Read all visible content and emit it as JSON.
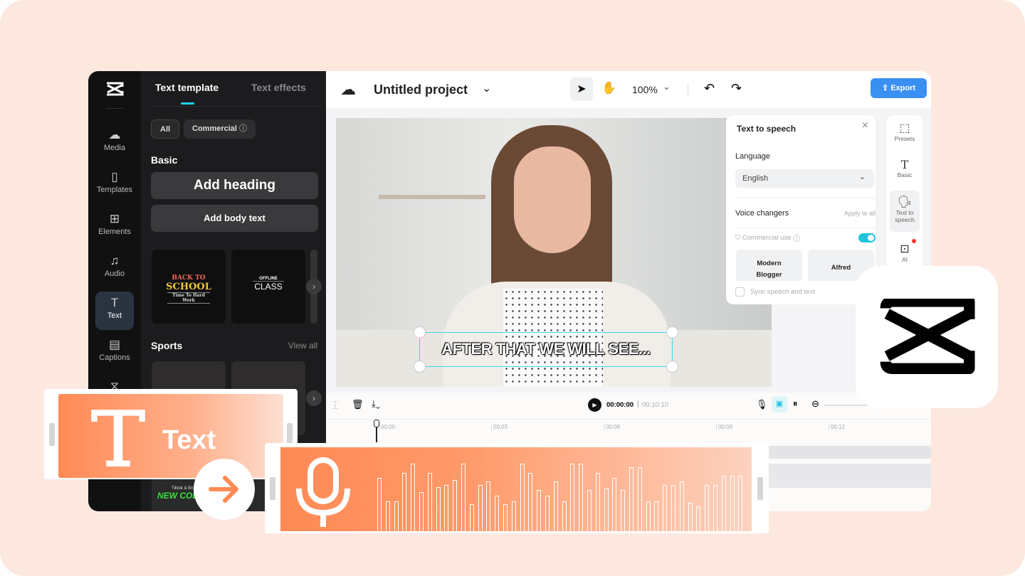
{
  "sidebar": {
    "items": [
      {
        "label": "Media",
        "icon": "cloud-upload-icon"
      },
      {
        "label": "Templates",
        "icon": "templates-icon"
      },
      {
        "label": "Elements",
        "icon": "elements-icon"
      },
      {
        "label": "Audio",
        "icon": "music-icon"
      },
      {
        "label": "Text",
        "icon": "text-icon",
        "active": true
      },
      {
        "label": "Captions",
        "icon": "captions-icon"
      },
      {
        "label": "Transitions",
        "icon": "transitions-icon"
      }
    ]
  },
  "panel": {
    "tabs": [
      {
        "label": "Text template",
        "active": true
      },
      {
        "label": "Text effects"
      }
    ],
    "filters": [
      "All",
      "Commercial"
    ],
    "basic_title": "Basic",
    "add_heading": "Add heading",
    "add_body": "Add body text",
    "cards": [
      {
        "line1": "BACK TO",
        "line2": "SCHOOL",
        "line3": "Time To Hard Work"
      },
      {
        "line1": "OFFLINE",
        "line2": "CLASS"
      }
    ],
    "sports_title": "Sports",
    "view_all": "View all",
    "bottom_card": {
      "line1": "Tiktok & Bro",
      "line2": "NEW COLLEC"
    }
  },
  "header": {
    "project_title": "Untitled project",
    "zoom": "100%",
    "export_label": "Export"
  },
  "canvas": {
    "caption": "AFTER THAT WE WILL SEE..."
  },
  "tts": {
    "title": "Text to speech",
    "language_label": "Language",
    "language_value": "English",
    "voice_changers": "Voice changers",
    "apply_all": "Apply to all",
    "commercial_use": "Commercial use",
    "commercial_on": true,
    "voices": [
      "Modern Blogger",
      "Alfred"
    ],
    "sync_label": "Sync speech and text",
    "sync_checked": false
  },
  "props": [
    {
      "label": "Presets"
    },
    {
      "label": "Basic"
    },
    {
      "label": "Text to speech",
      "active": true
    },
    {
      "label": "AI"
    }
  ],
  "timeline": {
    "current": "00:00:00",
    "total": "00:10:10",
    "ticks": [
      "00:00",
      "00:03",
      "00:06",
      "00:09",
      "00:12"
    ]
  },
  "promo": {
    "text_label": "Text",
    "waveform_levels": [
      0.75,
      0.42,
      0.42,
      0.82,
      0.95,
      0.55,
      0.82,
      0.62,
      0.65,
      0.72,
      0.95,
      0.38,
      0.65,
      0.7,
      0.5,
      0.38,
      0.42,
      0.95,
      0.82,
      0.58,
      0.5,
      0.7,
      0.42,
      0.95,
      0.95,
      0.58,
      0.82,
      0.6,
      0.75,
      0.58,
      0.9,
      0.9,
      0.42,
      0.42,
      0.65,
      0.65,
      0.7,
      0.4,
      0.35,
      0.65,
      0.65,
      0.78,
      0.78,
      0.78
    ],
    "accent": "#ff8a55"
  },
  "colors": {
    "accent_cyan": "#1fd2e6",
    "export_blue": "#3a8ff2",
    "peach_bg": "#fde8df"
  }
}
